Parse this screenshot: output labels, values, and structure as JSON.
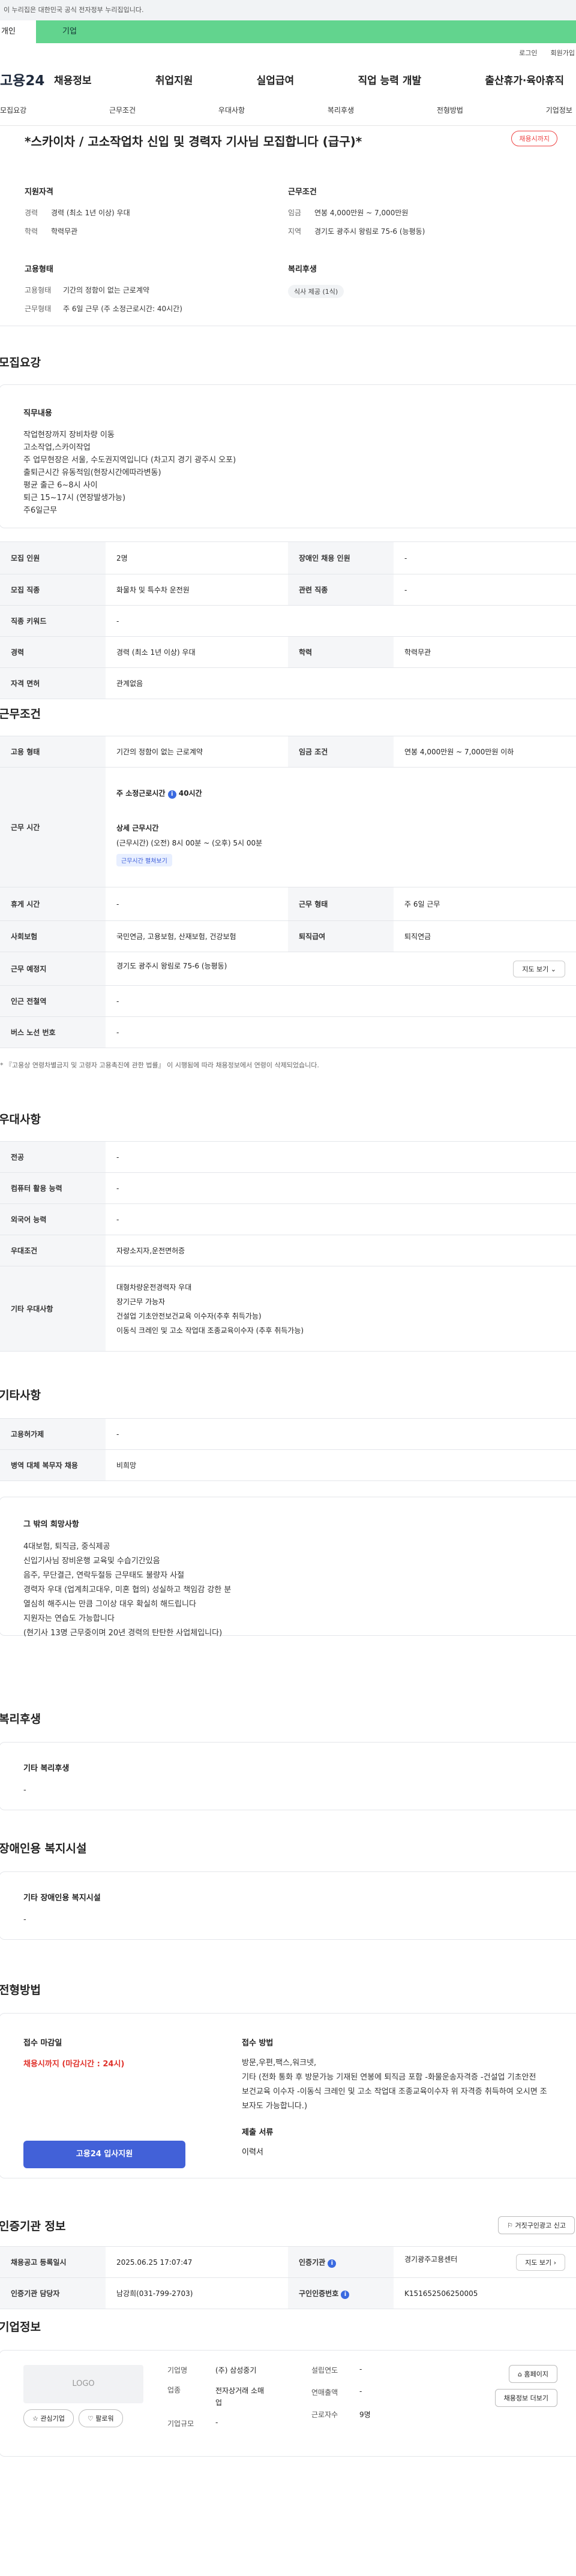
{
  "gov_banner": "이 누리집은 대한민국 공식 전자정부 누리집입니다.",
  "top_tabs": [
    "개인",
    "기업"
  ],
  "util_links": [
    "로그인",
    "회원가입"
  ],
  "site_name": "고용24",
  "gnb": [
    "채용정보",
    "취업지원",
    "실업급여",
    "직업 능력 개발",
    "출산휴가·육아휴직"
  ],
  "anchors": [
    "모집요강",
    "근무조건",
    "우대사항",
    "복리후생",
    "전형방법",
    "기업정보"
  ],
  "summary": {
    "title": "*스카이차 / 고소작업차 신입 및 경력자 기사님 모집합니다 (급구)*",
    "badge": "채용시까지",
    "qual_head": "지원자격",
    "qual": [
      {
        "k": "경력",
        "v": "경력 (최소 1년 이상) 우대"
      },
      {
        "k": "학력",
        "v": "학력무관"
      }
    ],
    "cond_head": "근무조건",
    "cond": [
      {
        "k": "임금",
        "v": "연봉 4,000만원 ~ 7,000만원"
      },
      {
        "k": "지역",
        "v": "경기도 광주시 왕림로 75-6 (능평동)"
      }
    ],
    "emp_head": "고용형태",
    "emp": [
      {
        "k": "고용형태",
        "v": "기간의 정함이 없는 근로계약"
      },
      {
        "k": "근무형태",
        "v": "주 6일 근무 (주 소정근로시간: 40시간)"
      }
    ],
    "welfare_head": "복리후생",
    "welfare_chip": "식사 제공 (1식)"
  },
  "recruit": {
    "heading": "모집요강",
    "duty_head": "직무내용",
    "duty_lines": [
      "작업현장까지 장비차량 이동",
      "고소작업,스카이작업",
      "주 업무현장은 서울, 수도권지역입니다 (차고지 경기 광주시 오포)",
      "출퇴근시간 유동적임(현장시간에따라변동)",
      "평균 출근 6~8시 사이",
      "퇴근 15~17시 (연장발생가능)",
      "주6일근무"
    ],
    "rows": [
      {
        "k1": "모집 인원",
        "v1": "2명",
        "k2": "장애인 채용 인원",
        "v2": "-"
      },
      {
        "k1": "모집 직종",
        "v1": "화물차 및 특수차 운전원",
        "k2": "관련 직종",
        "v2": "-"
      },
      {
        "k1": "직종 키워드",
        "v1": "-"
      },
      {
        "k1": "경력",
        "v1": "경력 (최소 1년 이상) 우대",
        "k2": "학력",
        "v2": "학력무관"
      },
      {
        "k1": "자격 면허",
        "v1": "관계없음"
      }
    ]
  },
  "work": {
    "heading": "근무조건",
    "row1": {
      "k1": "고용 형태",
      "v1": "기간의 정함이 없는 근로계약",
      "k2": "임금 조건",
      "v2": "연봉 4,000만원 ~ 7,000만원 이하"
    },
    "hours_label": "근무 시간",
    "hours_weekly": "주 소정근로시간",
    "hours_weekly_val": "40시간",
    "hours_detail_head": "상세 근무시간",
    "hours_detail": "(근무시간) (오전) 8시 00분 ~ (오후) 5시 00분",
    "hours_btn": "근무시간 펼쳐보기",
    "row3": {
      "k1": "휴게 시간",
      "v1": "-",
      "k2": "근무 형태",
      "v2": "주 6일 근무"
    },
    "row4": {
      "k1": "사회보험",
      "v1": "국민연금, 고용보험, 산재보험, 건강보험",
      "k2": "퇴직급여",
      "v2": "퇴직연금"
    },
    "row5": {
      "k1": "근무 예정지",
      "v1": "경기도 광주시 왕림로 75-6 (능평동)",
      "btn": "지도 보기"
    },
    "row6": {
      "k1": "인근 전철역",
      "v1": "-"
    },
    "row7": {
      "k1": "버스 노선 번호",
      "v1": "-"
    },
    "note": "* 『고용상 연령차별금지 및 고령자 고용촉진에 관한 법률』 이 시행됨에 따라 채용정보에서 연령이 삭제되었습니다."
  },
  "pref": {
    "heading": "우대사항",
    "rows": [
      {
        "k": "전공",
        "v": "-"
      },
      {
        "k": "컴퓨터 활용 능력",
        "v": "-"
      },
      {
        "k": "외국어 능력",
        "v": "-"
      },
      {
        "k": "우대조건",
        "v": "자량소지자,운전면허증"
      }
    ],
    "other_k": "기타 우대사항",
    "other_lines": [
      "대형차량운전경력자 우대",
      "장기근무 가능자",
      "건설업 기초안전보건교육 이수자(추후 취득가능)",
      "이동식 크레인 및 고소 작업대 조종교육이수자 (추후 취득가능)"
    ]
  },
  "etc": {
    "heading": "기타사항",
    "rows": [
      {
        "k": "고용허가제",
        "v": "-"
      },
      {
        "k": "병역 대체 복무자 채용",
        "v": "비희망"
      }
    ],
    "box_head": "그 밖의 희망사항",
    "box_lines": [
      "4대보험, 퇴직금, 중식제공",
      "신입기사님 장비운행 교육및 수습기간있음",
      "음주, 무단결근, 연락두절등 근무태도 불량자 사절",
      "경력자 우대 (업계최고대우, 미혼 협의) 성실하고 책임감 강한 분",
      "열심히 해주시는 만큼 그이상 대우 확실히 해드립니다",
      "지원자는 연습도 가능합니다",
      "(현기사 13명 근무중이며 20년 경력의 탄탄한 사업체입니다)"
    ]
  },
  "welfare": {
    "heading": "복리후생",
    "box_head": "기타 복리후생",
    "box_val": "-"
  },
  "disability": {
    "heading": "장애인용 복지시설",
    "box_head": "기타 장애인용 복지시설",
    "box_val": "-"
  },
  "process": {
    "heading": "전형방법",
    "deadline_head": "접수 마감일",
    "deadline": "채용시까지 (마감시간 : 24시)",
    "apply_btn": "고용24 입사지원",
    "method_head": "접수 방법",
    "method_lines": [
      "방문,우편,팩스,워크넷,",
      "기타 (전화 통화 후 방문가능 기재된 연봉에 퇴직금 포함 -화물운송자격증 -건설업 기초안전",
      "보건교육 이수자 -이동식 크레인 및 고소 작업대 조종교육이수자 위 자격증 취득하여 오시면 조",
      "보자도 가능합니다.)"
    ],
    "docs_head": "제출 서류",
    "docs_val": "이력서"
  },
  "agency": {
    "heading": "인증기관 정보",
    "report_btn": "거짓구인광고 신고",
    "rows": [
      {
        "k1": "채용공고 등록일시",
        "v1": "2025.06.25 17:07:47",
        "k2": "인증기관",
        "v2": "경기광주고용센터",
        "btn": "지도 보기"
      },
      {
        "k1": "인증기관 담당자",
        "v1": "남강희(031-799-2703)",
        "k2": "구인인증번호",
        "v2": "K151652506250005"
      }
    ]
  },
  "company": {
    "heading": "기업정보",
    "logo": "LOGO",
    "fav_btn": "관심기업",
    "follow_btn": "팔로워",
    "name_k": "기업명",
    "name_v": "(주) 삼성중기",
    "biz_k": "업종",
    "biz_v_lines": [
      "전자상거래 소매",
      "업"
    ],
    "scale_k": "기업규모",
    "scale_v": "-",
    "est_k": "설립연도",
    "est_v": "-",
    "rev_k": "연매출액",
    "rev_v": "-",
    "emp_k": "근로자수",
    "emp_v": "9명",
    "home_btn": "홈페이지",
    "jobs_btn": "채용정보 더보기"
  }
}
